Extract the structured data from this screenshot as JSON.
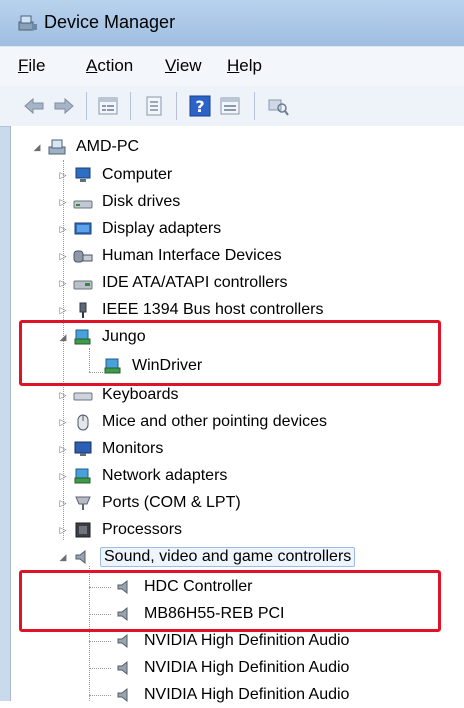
{
  "window": {
    "title": "Device Manager"
  },
  "menu": [
    {
      "label": "File",
      "accel": "F",
      "rest": "ile"
    },
    {
      "label": "Action",
      "accel": "A",
      "rest": "ction"
    },
    {
      "label": "View",
      "accel": "V",
      "rest": "iew"
    },
    {
      "label": "Help",
      "accel": "H",
      "rest": "elp"
    }
  ],
  "toolbar": {
    "buttons": [
      "back-arrow-icon",
      "forward-arrow-icon",
      "properties-icon",
      "update-driver-icon",
      "help-icon",
      "show-hidden-icon",
      "scan-hardware-icon"
    ]
  },
  "tree": {
    "root": "AMD-PC",
    "nodes": [
      {
        "label": "Computer",
        "icon": "computer-icon",
        "expanded": false
      },
      {
        "label": "Disk drives",
        "icon": "disk-drive-icon",
        "expanded": false
      },
      {
        "label": "Display adapters",
        "icon": "display-adapter-icon",
        "expanded": false
      },
      {
        "label": "Human Interface Devices",
        "icon": "hid-icon",
        "expanded": false
      },
      {
        "label": "IDE ATA/ATAPI controllers",
        "icon": "ide-controller-icon",
        "expanded": false
      },
      {
        "label": "IEEE 1394 Bus host controllers",
        "icon": "firewire-icon",
        "expanded": false
      },
      {
        "label": "Jungo",
        "icon": "jungo-icon",
        "expanded": true,
        "children": [
          "WinDriver"
        ]
      },
      {
        "label": "Keyboards",
        "icon": "keyboard-icon",
        "expanded": false
      },
      {
        "label": "Mice and other pointing devices",
        "icon": "mouse-icon",
        "expanded": false
      },
      {
        "label": "Monitors",
        "icon": "monitor-icon",
        "expanded": false
      },
      {
        "label": "Network adapters",
        "icon": "network-adapter-icon",
        "expanded": false
      },
      {
        "label": "Ports (COM & LPT)",
        "icon": "port-icon",
        "expanded": false
      },
      {
        "label": "Processors",
        "icon": "processor-icon",
        "expanded": false
      },
      {
        "label": "Sound, video and game controllers",
        "icon": "speaker-icon",
        "expanded": true,
        "selected": true,
        "children": [
          "HDC Controller",
          "MB86H55-REB PCI",
          "NVIDIA High Definition Audio",
          "NVIDIA High Definition Audio",
          "NVIDIA High Definition Audio"
        ]
      }
    ]
  },
  "colors": {
    "highlight_box": "#e01228",
    "selection_border": "#9fbbe0",
    "titlebar": "#a9c6e6"
  }
}
